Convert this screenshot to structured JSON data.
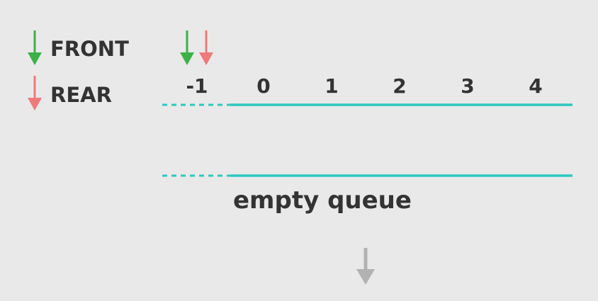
{
  "legend": {
    "front_label": "FRONT",
    "rear_label": "REAR"
  },
  "queue": {
    "indices": [
      "-1",
      "0",
      "1",
      "2",
      "3",
      "4"
    ],
    "caption": "empty queue"
  },
  "colors": {
    "front": "#3db048",
    "rear": "#f07a7a",
    "queue_line": "#2dc8c0",
    "text": "#333333",
    "flow_arrow": "#b2b2b2",
    "background": "#e9e9e9"
  },
  "icons": {
    "front": "arrow-down-icon",
    "rear": "arrow-down-icon",
    "next_step": "arrow-down-icon"
  }
}
